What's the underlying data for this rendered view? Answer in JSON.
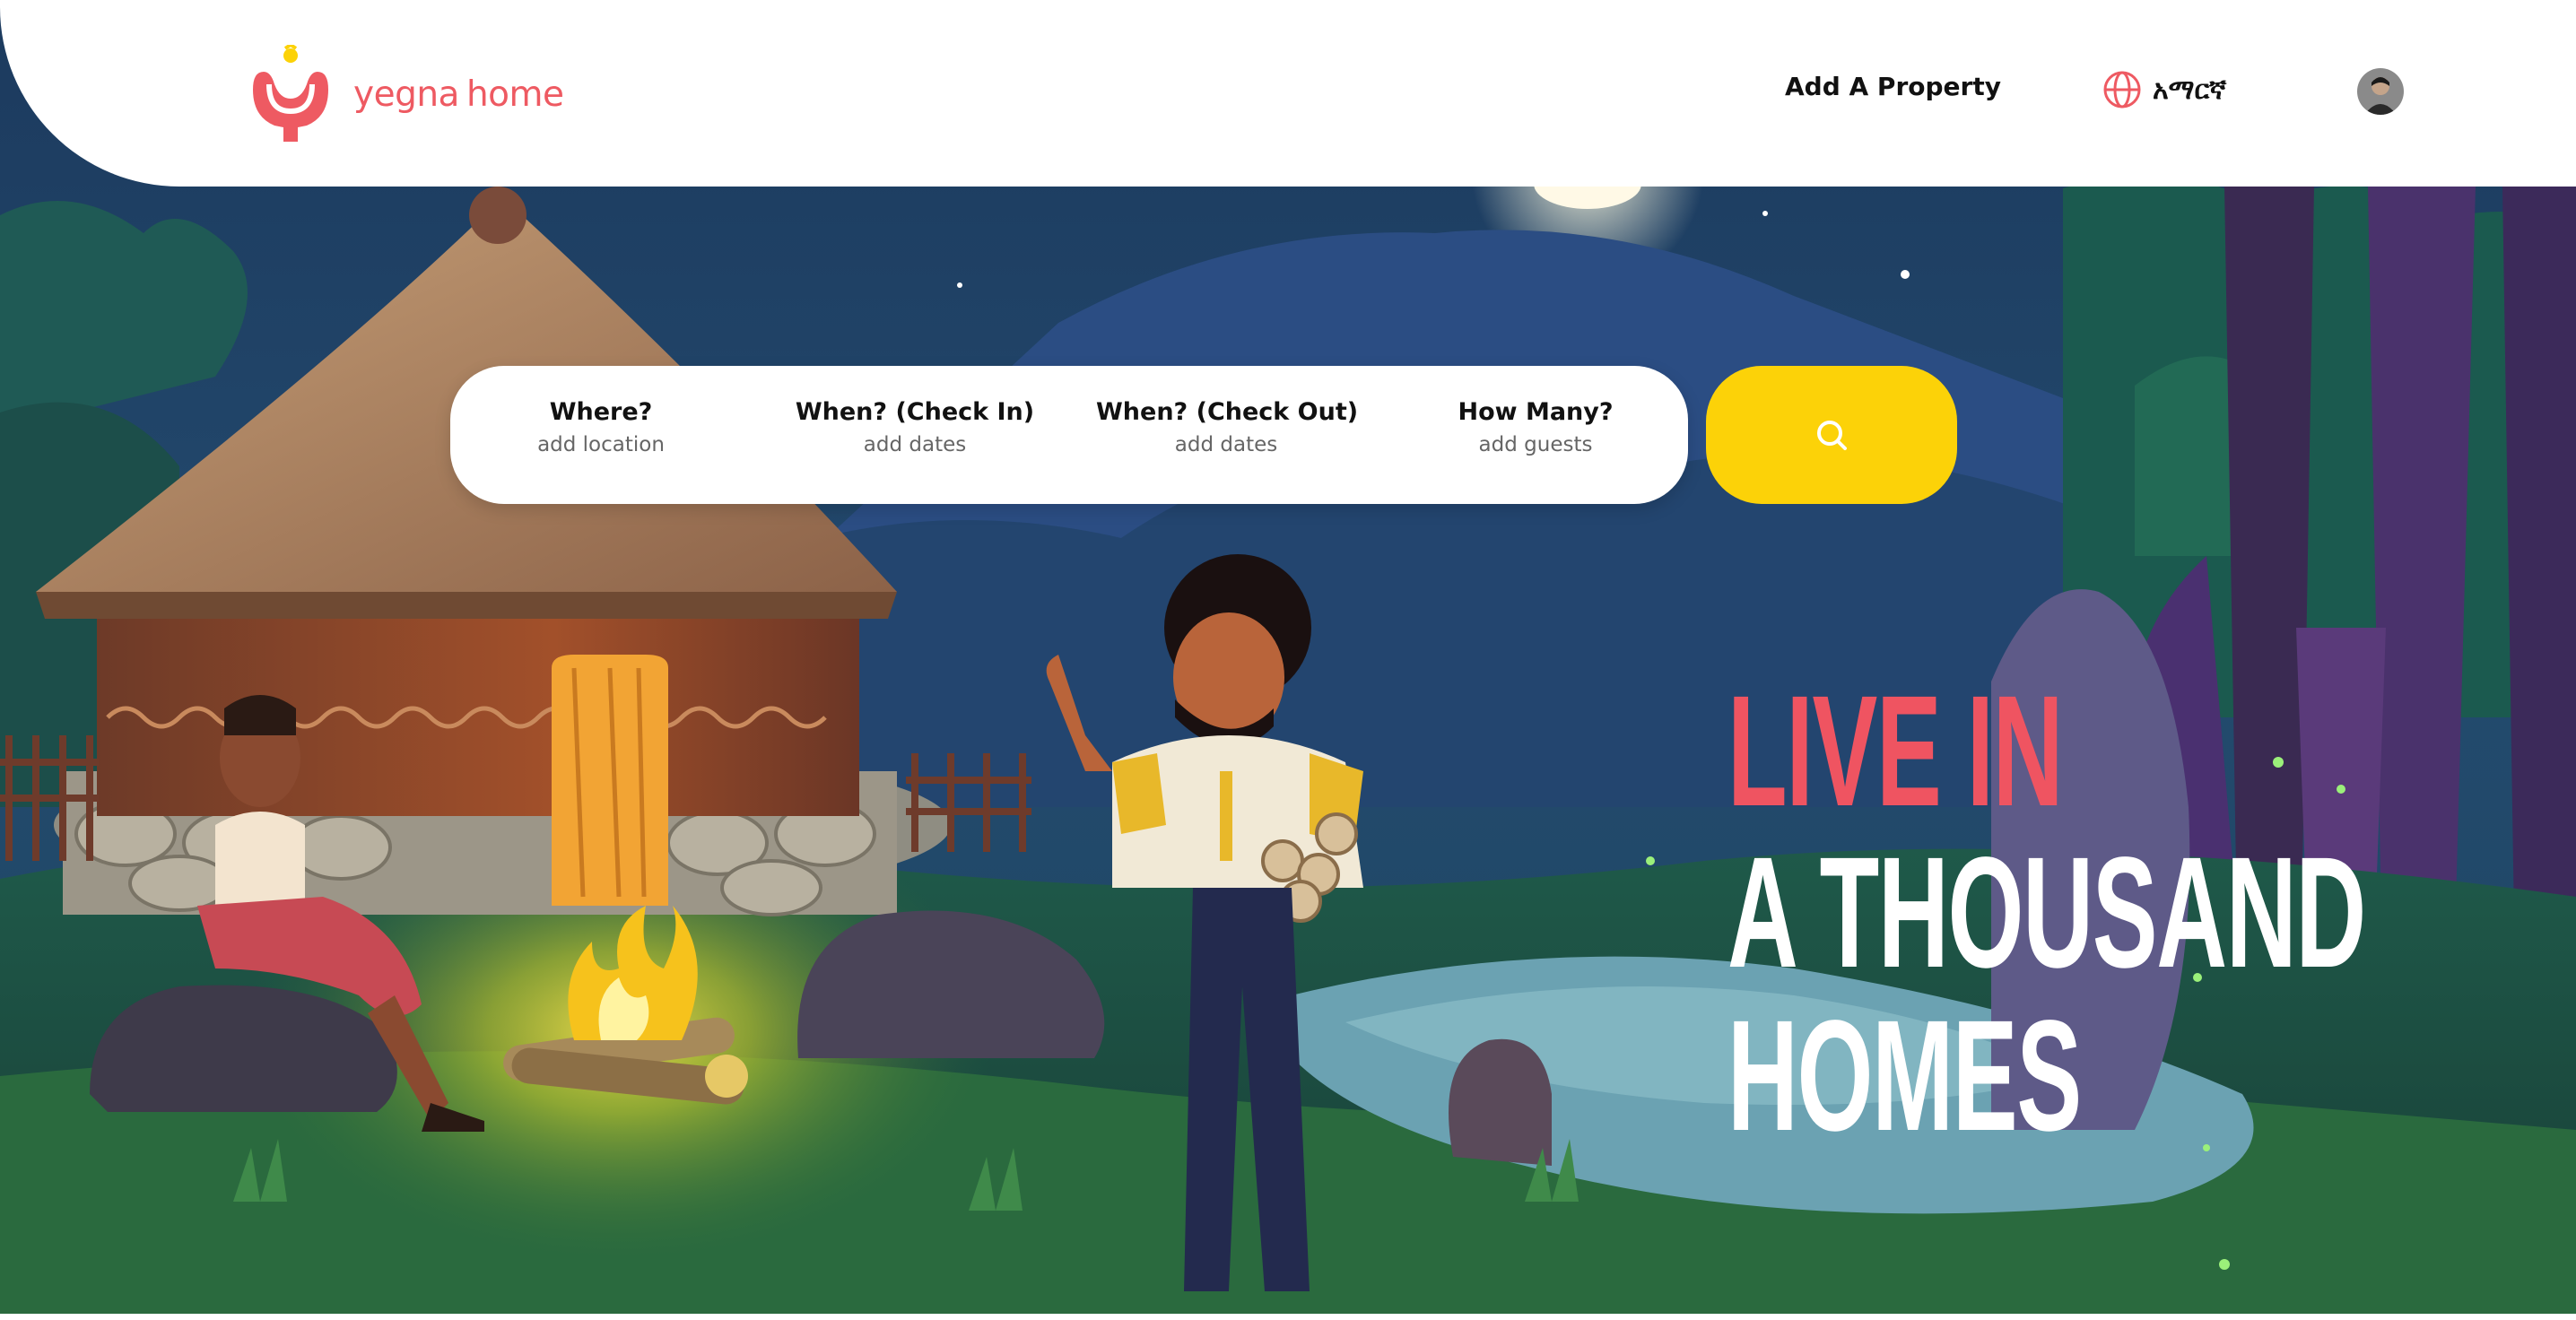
{
  "header": {
    "logo": {
      "word1": "yegna",
      "word2": "home"
    },
    "nav": {
      "add_property": "Add A Property",
      "language": "አማርኛ"
    }
  },
  "search": {
    "fields": [
      {
        "label": "Where?",
        "placeholder": "add location"
      },
      {
        "label": "When? (Check In)",
        "placeholder": "add dates"
      },
      {
        "label": "When? (Check Out)",
        "placeholder": "add dates"
      },
      {
        "label": "How Many?",
        "placeholder": "add guests"
      }
    ],
    "button_icon": "search-icon"
  },
  "hero": {
    "headline_line1": "LIVE IN",
    "headline_line2": "A THOUSAND",
    "headline_line3": "HOMES"
  },
  "colors": {
    "brand": "#ee5a62",
    "accent_yellow": "#fcd208",
    "night_sky": "#1f3b5a"
  }
}
